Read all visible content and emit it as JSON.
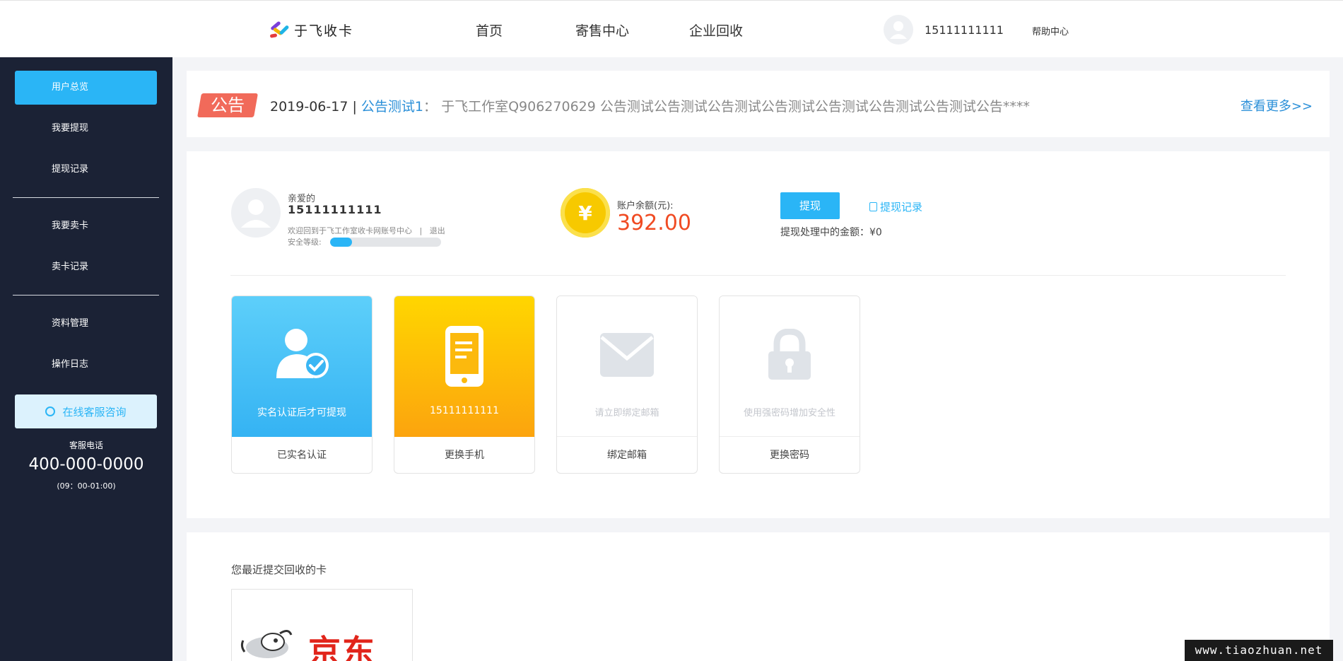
{
  "header": {
    "logo_text": "于飞收卡",
    "nav": [
      "首页",
      "寄售中心",
      "企业回收"
    ],
    "username": "15111111111",
    "help": "帮助中心"
  },
  "sidebar": {
    "items": [
      "用户总览",
      "我要提现",
      "提现记录",
      "我要卖卡",
      "卖卡记录",
      "资料管理",
      "操作日志"
    ],
    "active_index": 0,
    "service_btn": "在线客服咨询",
    "hotline_label": "客服电话",
    "hotline_number": "400-000-0000",
    "hotline_hours": "(09：00-01:00)"
  },
  "notice": {
    "badge": "公告",
    "date": "2019-06-17 |",
    "title": "公告测试1",
    "separator": "：",
    "body": "于飞工作室Q906270629 公告测试公告测试公告测试公告测试公告测试公告测试公告测试公告****",
    "more": "查看更多>>"
  },
  "account": {
    "greet": "亲爱的",
    "name": "15111111111",
    "welcome": "欢迎回到于飞工作室收卡网账号中心",
    "divider": "|",
    "logout": "退出",
    "security_label": "安全等级:",
    "security_level": 0.2,
    "coin_symbol": "¥",
    "balance_label": "账户余额(元):",
    "balance": "392.00",
    "withdraw_btn": "提现",
    "withdraw_record": "提现记录",
    "processing_label": "提现处理中的金额：",
    "processing_value": "¥0"
  },
  "cards": [
    {
      "label": "实名认证后才可提现",
      "action": "已实名认证",
      "style": "blue",
      "icon": "user-verified-icon"
    },
    {
      "label": "15111111111",
      "action": "更换手机",
      "style": "yellow",
      "icon": "phone-icon"
    },
    {
      "label": "请立即绑定邮箱",
      "action": "绑定邮箱",
      "style": "plain",
      "icon": "mail-icon"
    },
    {
      "label": "使用强密码增加安全性",
      "action": "更换密码",
      "style": "plain",
      "icon": "lock-icon"
    }
  ],
  "recent": {
    "title": "您最近提交回收的卡",
    "card_brand": "京东"
  },
  "watermark": "www.tiaozhuan.net",
  "colors": {
    "accent": "#2ab5f6",
    "sidebar_bg": "#1b2235",
    "notice_badge": "#f16a5a",
    "balance": "#f04b23",
    "link": "#2a8fd8"
  }
}
